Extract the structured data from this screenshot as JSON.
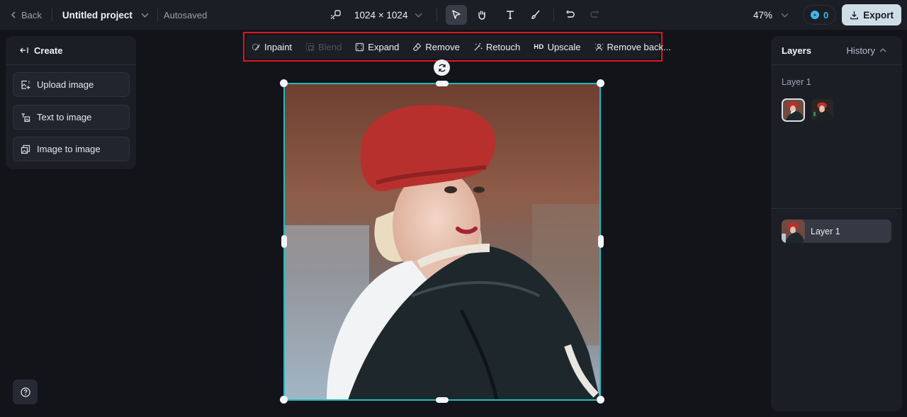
{
  "topbar": {
    "back_label": "Back",
    "project_name": "Untitled project",
    "save_status": "Autosaved",
    "canvas_size": "1024 × 1024",
    "zoom_level": "47%",
    "credits": "0",
    "export_label": "Export"
  },
  "tools": [
    {
      "name": "select",
      "icon": "cursor-icon",
      "active": true
    },
    {
      "name": "hand",
      "icon": "hand-icon",
      "active": false
    },
    {
      "name": "text",
      "icon": "text-icon",
      "active": false
    },
    {
      "name": "brush",
      "icon": "brush-icon",
      "active": false
    },
    {
      "name": "undo",
      "icon": "undo-icon",
      "active": false
    },
    {
      "name": "redo",
      "icon": "redo-icon",
      "active": false,
      "disabled": true
    }
  ],
  "edit_toolbar": {
    "items": [
      {
        "label": "Inpaint",
        "icon": "inpaint-icon",
        "disabled": false
      },
      {
        "label": "Blend",
        "icon": "blend-icon",
        "disabled": true
      },
      {
        "label": "Expand",
        "icon": "expand-icon",
        "disabled": false
      },
      {
        "label": "Remove",
        "icon": "eraser-icon",
        "disabled": false
      },
      {
        "label": "Retouch",
        "icon": "magic-wand-icon",
        "disabled": false
      },
      {
        "label": "Upscale",
        "icon": "hd-icon",
        "badge": "HD",
        "disabled": false
      },
      {
        "label": "Remove back...",
        "icon": "remove-background-icon",
        "disabled": false
      }
    ],
    "highlight_color": "#e0161b"
  },
  "left_panel": {
    "title": "Create",
    "items": [
      {
        "label": "Upload image",
        "icon": "upload-image-icon"
      },
      {
        "label": "Text to image",
        "icon": "text-to-image-icon"
      },
      {
        "label": "Image to image",
        "icon": "image-to-image-icon"
      }
    ]
  },
  "right_panel": {
    "title": "Layers",
    "history_label": "History",
    "group_label": "Layer 1",
    "layers": [
      {
        "label": "Layer 1"
      }
    ]
  },
  "colors": {
    "accent_selection": "#1fbcc1",
    "credits": "#3fb6e6",
    "export_bg": "#cfdde6"
  }
}
